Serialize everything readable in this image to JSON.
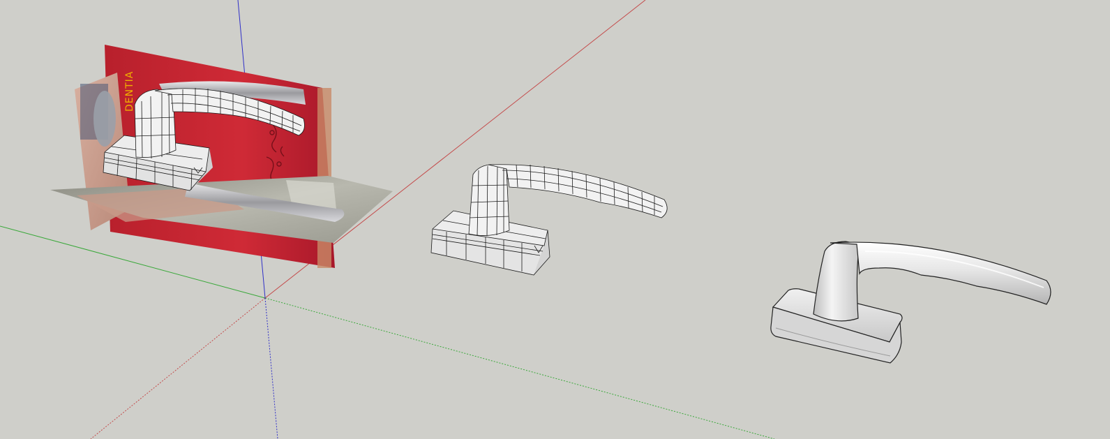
{
  "scene": {
    "background_color": "#cfcfca",
    "axis_colors": {
      "red": "#c44a4a",
      "green": "#3aa83a",
      "blue": "#2f2fc8"
    },
    "photo_reference": {
      "text": "DENTIA",
      "accent_color": "#c0283a"
    },
    "models": [
      {
        "name": "handle-with-reference-photo",
        "style": "wireframe"
      },
      {
        "name": "handle-wireframe",
        "style": "wireframe"
      },
      {
        "name": "handle-smooth",
        "style": "smooth-shaded"
      }
    ]
  }
}
